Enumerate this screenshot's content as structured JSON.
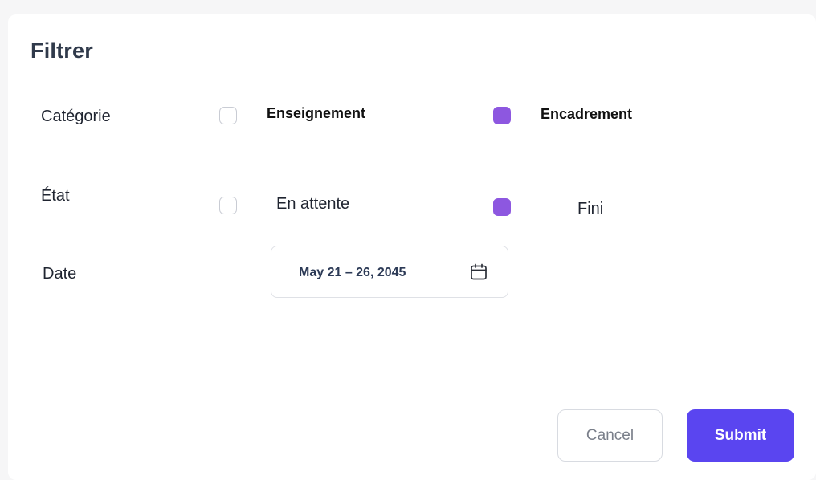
{
  "dialog": {
    "title": "Filtrer"
  },
  "filters": {
    "category": {
      "label": "Catégorie",
      "options": [
        {
          "label": "Enseignement",
          "checked": false
        },
        {
          "label": "Encadrement",
          "checked": true
        }
      ]
    },
    "state": {
      "label": "État",
      "options": [
        {
          "label": "En attente",
          "checked": false
        },
        {
          "label": "Fini",
          "checked": true
        }
      ]
    },
    "date": {
      "label": "Date",
      "value": "May 21 – 26, 2045",
      "icon": "calendar-icon"
    }
  },
  "actions": {
    "cancel_label": "Cancel",
    "submit_label": "Submit"
  },
  "colors": {
    "checkbox_checked": "#8d57e0",
    "submit_bg": "#5a45f0",
    "title": "#303a4b"
  }
}
